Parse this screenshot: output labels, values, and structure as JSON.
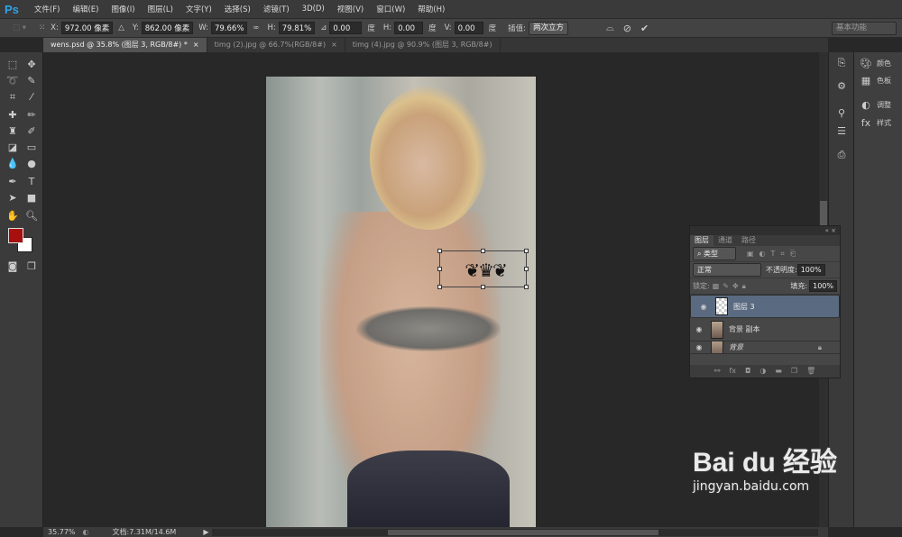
{
  "app": {
    "logo": "Ps"
  },
  "menu": [
    "文件(F)",
    "编辑(E)",
    "图像(I)",
    "图层(L)",
    "文字(Y)",
    "选择(S)",
    "滤镜(T)",
    "3D(D)",
    "视图(V)",
    "窗口(W)",
    "帮助(H)"
  ],
  "options": {
    "x_label": "X:",
    "x_value": "972.00 像素",
    "y_label": "Y:",
    "y_value": "862.00 像素",
    "w_label": "W:",
    "w_value": "79.66%",
    "h_label": "H:",
    "h_value": "79.81%",
    "angle_value": "0.00",
    "angle_unit": "度",
    "skew_h_label": "H:",
    "skew_h_value": "0.00",
    "skew_h_unit": "度",
    "skew_v_label": "V:",
    "skew_v_value": "0.00",
    "skew_v_unit": "度",
    "interp_label": "插值:",
    "interp_value": "两次立方",
    "workspace": "基本功能"
  },
  "tabs": [
    {
      "label": "wens.psd @ 35.8% (图层 3, RGB/8#) *",
      "active": true
    },
    {
      "label": "timg (2).jpg @ 66.7%(RGB/8#)",
      "active": false
    },
    {
      "label": "timg (4).jpg @ 90.9% (图层 3, RGB/8#)",
      "active": false
    }
  ],
  "colors": {
    "foreground": "#a80f0f",
    "background": "#ffffff",
    "accent": "#2fa3e8"
  },
  "dock": {
    "color": "颜色",
    "swatches": "色板",
    "adjustments": "调整",
    "styles": "样式"
  },
  "layers_panel": {
    "tabs": [
      "图层",
      "通道",
      "路径"
    ],
    "filter": "类型",
    "blend_mode": "正常",
    "opacity_label": "不透明度:",
    "opacity": "100%",
    "lock_label": "锁定:",
    "fill_label": "填充:",
    "fill": "100%",
    "layers": [
      {
        "name": "图层 3",
        "selected": true
      },
      {
        "name": "背景 副本",
        "selected": false
      },
      {
        "name": "背景",
        "selected": false,
        "locked": true
      }
    ]
  },
  "status": {
    "zoom": "35.77%",
    "doc": "文档:7.31M/14.6M"
  },
  "watermark": {
    "logo": "Bai du 经验",
    "url": "jingyan.baidu.com"
  }
}
